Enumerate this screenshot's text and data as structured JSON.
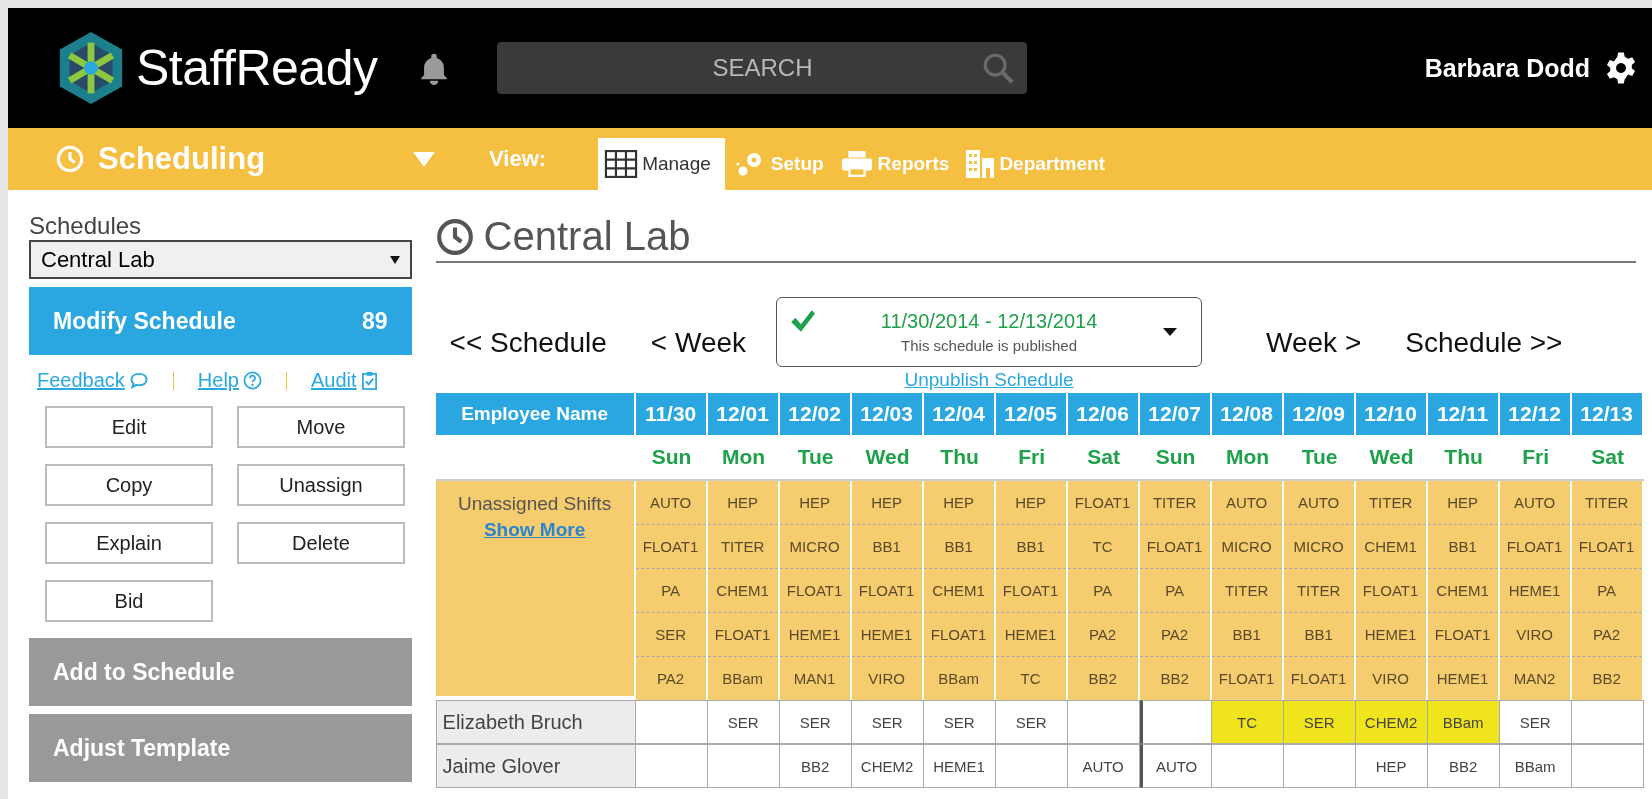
{
  "header": {
    "logo": "StaffReady",
    "search": {
      "placeholder": "SEARCH"
    },
    "user": "Barbara Dodd"
  },
  "nav": {
    "module": "Scheduling",
    "view_label": "View:",
    "tabs": [
      {
        "label": "Manage",
        "kind": "grid",
        "selected": true
      },
      {
        "label": "Setup",
        "kind": "gears",
        "selected": false
      },
      {
        "label": "Reports",
        "kind": "printer",
        "selected": false
      },
      {
        "label": "Department",
        "kind": "building",
        "selected": false
      }
    ]
  },
  "sidebar": {
    "label": "Schedules",
    "schedule": "Central Lab",
    "panels": [
      {
        "label": "Modify Schedule",
        "count": "89",
        "expanded": true
      },
      {
        "label": "Add to Schedule",
        "expanded": false
      },
      {
        "label": "Adjust Template",
        "expanded": false
      }
    ],
    "links": [
      {
        "label": "Feedback",
        "kind": "comment"
      },
      {
        "label": "Help",
        "kind": "help"
      },
      {
        "label": "Audit",
        "kind": "audit"
      }
    ],
    "buttons": [
      "Edit",
      "Move",
      "Copy",
      "Unassign",
      "Explain",
      "Delete",
      "Bid"
    ]
  },
  "main": {
    "title": "Central Lab",
    "prev_schedule": "<< Schedule",
    "prev_week": "< Week",
    "next_week": "Week >",
    "next_schedule": "Schedule >>",
    "period": {
      "range": "11/30/2014 - 12/13/2014",
      "status": "This schedule is published",
      "published": true
    },
    "unpublish_link": "Unpublish Schedule"
  },
  "table": {
    "name_header": "Employee Name",
    "unassigned_label": "Unassigned Shifts",
    "show_more": "Show More",
    "days": [
      {
        "date": "11/30",
        "weekday": "Sun",
        "unassigned": [
          "AUTO",
          "FLOAT1",
          "PA",
          "SER",
          "PA2"
        ]
      },
      {
        "date": "12/01",
        "weekday": "Mon",
        "unassigned": [
          "HEP",
          "TITER",
          "CHEM1",
          "FLOAT1",
          "BBam"
        ]
      },
      {
        "date": "12/02",
        "weekday": "Tue",
        "unassigned": [
          "HEP",
          "MICRO",
          "FLOAT1",
          "HEME1",
          "MAN1"
        ]
      },
      {
        "date": "12/03",
        "weekday": "Wed",
        "unassigned": [
          "HEP",
          "BB1",
          "FLOAT1",
          "HEME1",
          "VIRO"
        ]
      },
      {
        "date": "12/04",
        "weekday": "Thu",
        "unassigned": [
          "HEP",
          "BB1",
          "CHEM1",
          "FLOAT1",
          "BBam"
        ]
      },
      {
        "date": "12/05",
        "weekday": "Fri",
        "unassigned": [
          "HEP",
          "BB1",
          "FLOAT1",
          "HEME1",
          "TC"
        ]
      },
      {
        "date": "12/06",
        "weekday": "Sat",
        "unassigned": [
          "FLOAT1",
          "TC",
          "PA",
          "PA2",
          "BB2"
        ]
      },
      {
        "date": "12/07",
        "weekday": "Sun",
        "unassigned": [
          "TITER",
          "FLOAT1",
          "PA",
          "PA2",
          "BB2"
        ]
      },
      {
        "date": "12/08",
        "weekday": "Mon",
        "unassigned": [
          "AUTO",
          "MICRO",
          "TITER",
          "BB1",
          "FLOAT1"
        ]
      },
      {
        "date": "12/09",
        "weekday": "Tue",
        "unassigned": [
          "AUTO",
          "MICRO",
          "TITER",
          "BB1",
          "FLOAT1"
        ]
      },
      {
        "date": "12/10",
        "weekday": "Wed",
        "unassigned": [
          "TITER",
          "CHEM1",
          "FLOAT1",
          "HEME1",
          "VIRO"
        ]
      },
      {
        "date": "12/11",
        "weekday": "Thu",
        "unassigned": [
          "HEP",
          "BB1",
          "CHEM1",
          "FLOAT1",
          "HEME1"
        ]
      },
      {
        "date": "12/12",
        "weekday": "Fri",
        "unassigned": [
          "AUTO",
          "FLOAT1",
          "HEME1",
          "VIRO",
          "MAN2"
        ]
      },
      {
        "date": "12/13",
        "weekday": "Sat",
        "unassigned": [
          "TITER",
          "FLOAT1",
          "PA",
          "PA2",
          "BB2"
        ]
      }
    ],
    "employees": [
      {
        "name": "Elizabeth Bruch",
        "cells": [
          {},
          {
            "shift": "SER",
            "highlighted": false
          },
          {
            "shift": "SER",
            "highlighted": false
          },
          {
            "shift": "SER",
            "highlighted": false
          },
          {
            "shift": "SER",
            "highlighted": false
          },
          {
            "shift": "SER",
            "highlighted": false
          },
          {},
          {},
          {
            "shift": "TC",
            "highlighted": true
          },
          {
            "shift": "SER",
            "highlighted": true
          },
          {
            "shift": "CHEM2",
            "highlighted": true
          },
          {
            "shift": "BBam",
            "highlighted": true
          },
          {
            "shift": "SER",
            "highlighted": false
          },
          {}
        ]
      },
      {
        "name": "Jaime Glover",
        "cells": [
          {},
          {},
          {
            "shift": "BB2",
            "highlighted": false
          },
          {
            "shift": "CHEM2",
            "highlighted": false
          },
          {
            "shift": "HEME1",
            "highlighted": false
          },
          {},
          {
            "shift": "AUTO",
            "highlighted": false
          },
          {
            "shift": "AUTO",
            "highlighted": false
          },
          {},
          {},
          {
            "shift": "HEP",
            "highlighted": false
          },
          {
            "shift": "BB2",
            "highlighted": false
          },
          {
            "shift": "BBam",
            "highlighted": false
          },
          {}
        ]
      }
    ]
  }
}
